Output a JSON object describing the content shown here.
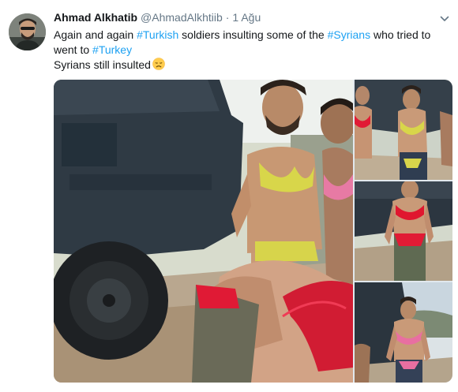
{
  "tweet": {
    "author_name": "Ahmad Alkhatib",
    "author_handle": "@AhmadAlkhtiib",
    "separator": "·",
    "timestamp": "1 Ağu",
    "text_line1": {
      "t1": "Again and again ",
      "h1": "#Turkish",
      "t2": " soldiers insulting some of the ",
      "h2": "#Syrians",
      "t3": " who tried to"
    },
    "text_line2": {
      "t1": "went to ",
      "h1": "#Turkey"
    },
    "text_line3": "Syrians still insulted",
    "emoji": "disappointed-face-emoji",
    "media_count": 4
  },
  "colors": {
    "name": "#14171a",
    "muted": "#657786",
    "hashtag": "#1da1f2",
    "background": "#ffffff"
  },
  "icons": {
    "caret": "chevron-down-icon",
    "avatar": "avatar"
  }
}
